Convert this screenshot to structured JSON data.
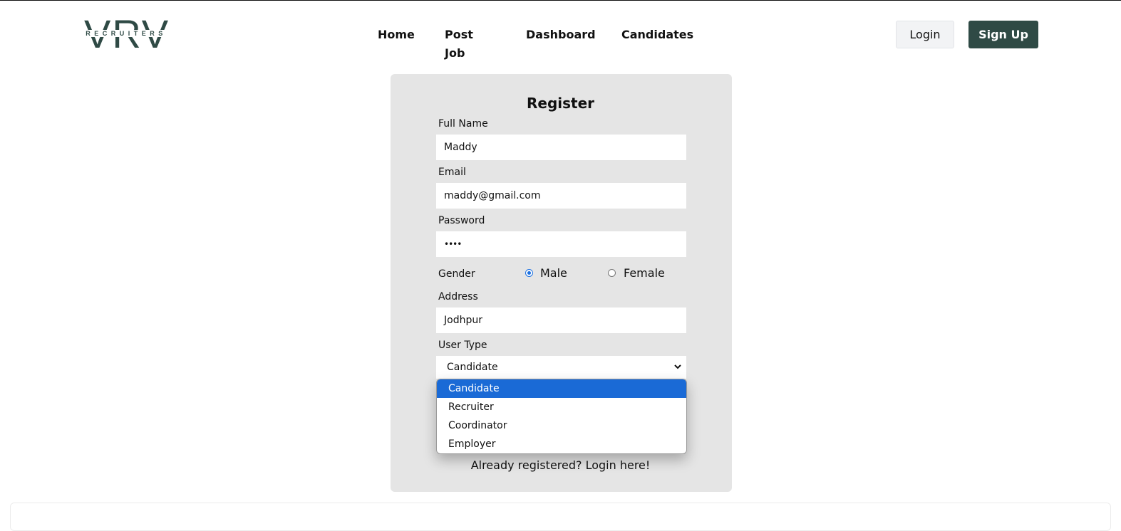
{
  "brand": {
    "logo_main": "VRV",
    "logo_sub": "RECRUITERS"
  },
  "nav": {
    "home": "Home",
    "post_job": "Post Job",
    "dashboard": "Dashboard",
    "candidates": "Candidates"
  },
  "auth": {
    "login": "Login",
    "signup": "Sign Up"
  },
  "form": {
    "title": "Register",
    "full_name_label": "Full Name",
    "full_name_value": "Maddy",
    "email_label": "Email",
    "email_value": "maddy@gmail.com",
    "password_label": "Password",
    "password_value": "••••",
    "gender_label": "Gender",
    "gender_options": [
      "Male",
      "Female"
    ],
    "gender_selected": "Male",
    "address_label": "Address",
    "address_value": "Jodhpur",
    "user_type_label": "User Type",
    "user_type_selected": "Candidate",
    "user_type_options": [
      "Candidate",
      "Recruiter",
      "Coordinator",
      "Employer"
    ],
    "already_registered": "Already registered? Login here!"
  },
  "colors": {
    "brand_dark": "#2f4a45",
    "card_bg": "#e5e5e5",
    "select_highlight": "#1a6ad6",
    "radio_accent": "#1a6fe0"
  }
}
